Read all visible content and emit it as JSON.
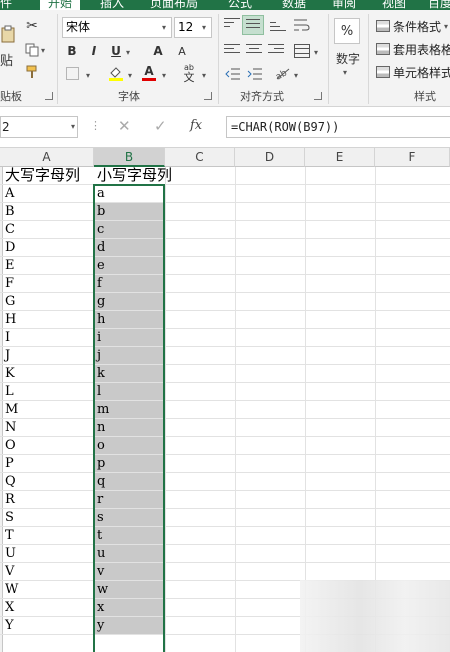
{
  "ribbon": {
    "tabs": [
      "件",
      "开始",
      "插入",
      "页面布局",
      "公式",
      "数据",
      "审阅",
      "视图",
      "百度"
    ],
    "font": {
      "name": "宋体",
      "size": "12",
      "bold": "B",
      "italic": "I",
      "underline": "U",
      "grow": "A",
      "shrink": "A",
      "font_color_letter": "A",
      "wen": "文",
      "label": "字体"
    },
    "clipboard": {
      "cut": "✂",
      "paste": "贴",
      "label": "贴板"
    },
    "alignment": {
      "label": "对齐方式"
    },
    "number": {
      "percent": "%",
      "label": "数字"
    },
    "styles": {
      "conditional": "条件格式",
      "table": "套用表格格",
      "cell": "单元格样式",
      "label": "样式"
    }
  },
  "formula_bar": {
    "name_box": "2",
    "cancel": "✕",
    "enter": "✓",
    "fx": "fx",
    "formula": "=CHAR(ROW(B97))"
  },
  "columns": [
    "A",
    "B",
    "C",
    "D",
    "E",
    "F"
  ],
  "header_row": {
    "a": "大写字母列",
    "b": "小写字母列"
  },
  "rows": [
    {
      "a": "A",
      "b": "a"
    },
    {
      "a": "B",
      "b": "b"
    },
    {
      "a": "C",
      "b": "c"
    },
    {
      "a": "D",
      "b": "d"
    },
    {
      "a": "E",
      "b": "e"
    },
    {
      "a": "F",
      "b": "f"
    },
    {
      "a": "G",
      "b": "g"
    },
    {
      "a": "H",
      "b": "h"
    },
    {
      "a": "I",
      "b": "i"
    },
    {
      "a": "J",
      "b": "j"
    },
    {
      "a": "K",
      "b": "k"
    },
    {
      "a": "L",
      "b": "l"
    },
    {
      "a": "M",
      "b": "m"
    },
    {
      "a": "N",
      "b": "n"
    },
    {
      "a": "O",
      "b": "o"
    },
    {
      "a": "P",
      "b": "p"
    },
    {
      "a": "Q",
      "b": "q"
    },
    {
      "a": "R",
      "b": "r"
    },
    {
      "a": "S",
      "b": "s"
    },
    {
      "a": "T",
      "b": "t"
    },
    {
      "a": "U",
      "b": "u"
    },
    {
      "a": "V",
      "b": "v"
    },
    {
      "a": "W",
      "b": "w"
    },
    {
      "a": "X",
      "b": "x"
    },
    {
      "a": "Y",
      "b": "y"
    }
  ],
  "colors": {
    "accent": "#217346",
    "selection_fill": "#c9c9c9"
  }
}
